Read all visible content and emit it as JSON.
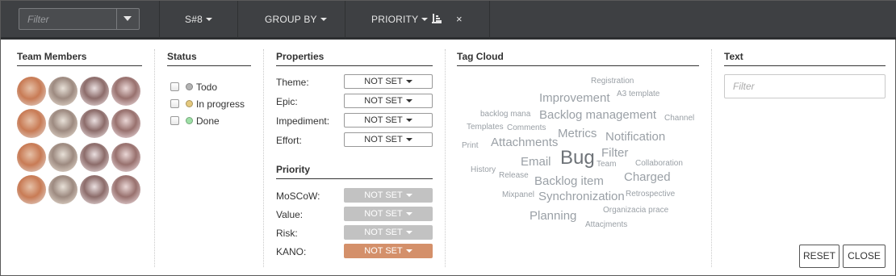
{
  "toolbar": {
    "filter_placeholder": "Filter",
    "sprint_label": "S#8",
    "group_by_label": "GROUP BY",
    "priority_label": "PRIORITY",
    "close_glyph": "×"
  },
  "team_members": {
    "title": "Team Members"
  },
  "status": {
    "title": "Status",
    "items": [
      {
        "label": "Todo",
        "color": "#b3b3b3"
      },
      {
        "label": "In progress",
        "color": "#e5c97e"
      },
      {
        "label": "Done",
        "color": "#9ee0a6"
      }
    ]
  },
  "properties": {
    "title": "Properties",
    "rows": [
      {
        "label": "Theme:",
        "value": "NOT SET"
      },
      {
        "label": "Epic:",
        "value": "NOT SET"
      },
      {
        "label": "Impediment:",
        "value": "NOT SET"
      },
      {
        "label": "Effort:",
        "value": "NOT SET"
      }
    ]
  },
  "priority": {
    "title": "Priority",
    "rows": [
      {
        "label": "MoSCoW:",
        "value": "NOT SET",
        "color": "#c2c2c2"
      },
      {
        "label": "Value:",
        "value": "NOT SET",
        "color": "#c2c2c2"
      },
      {
        "label": "Risk:",
        "value": "NOT SET",
        "color": "#c2c2c2"
      },
      {
        "label": "KANO:",
        "value": "NOT SET",
        "color": "#d4906a"
      }
    ]
  },
  "tag_cloud": {
    "title": "Tag Cloud",
    "tags": [
      "Registration",
      "Improvement",
      "A3 template",
      "backlog mana",
      "Backlog management",
      "Channel",
      "Templates",
      "Comments",
      "Metrics",
      "Notification",
      "Print",
      "Attachments",
      "Filter",
      "Email",
      "Bug",
      "Team",
      "Collaboration",
      "History",
      "Release",
      "Backlog item",
      "Charged",
      "Mixpanel",
      "Synchronization",
      "Retrospective",
      "Planning",
      "Organizacia prace",
      "Attacjments"
    ]
  },
  "text_section": {
    "title": "Text",
    "filter_placeholder": "Filter"
  },
  "buttons": {
    "reset": "RESET",
    "close": "CLOSE"
  }
}
